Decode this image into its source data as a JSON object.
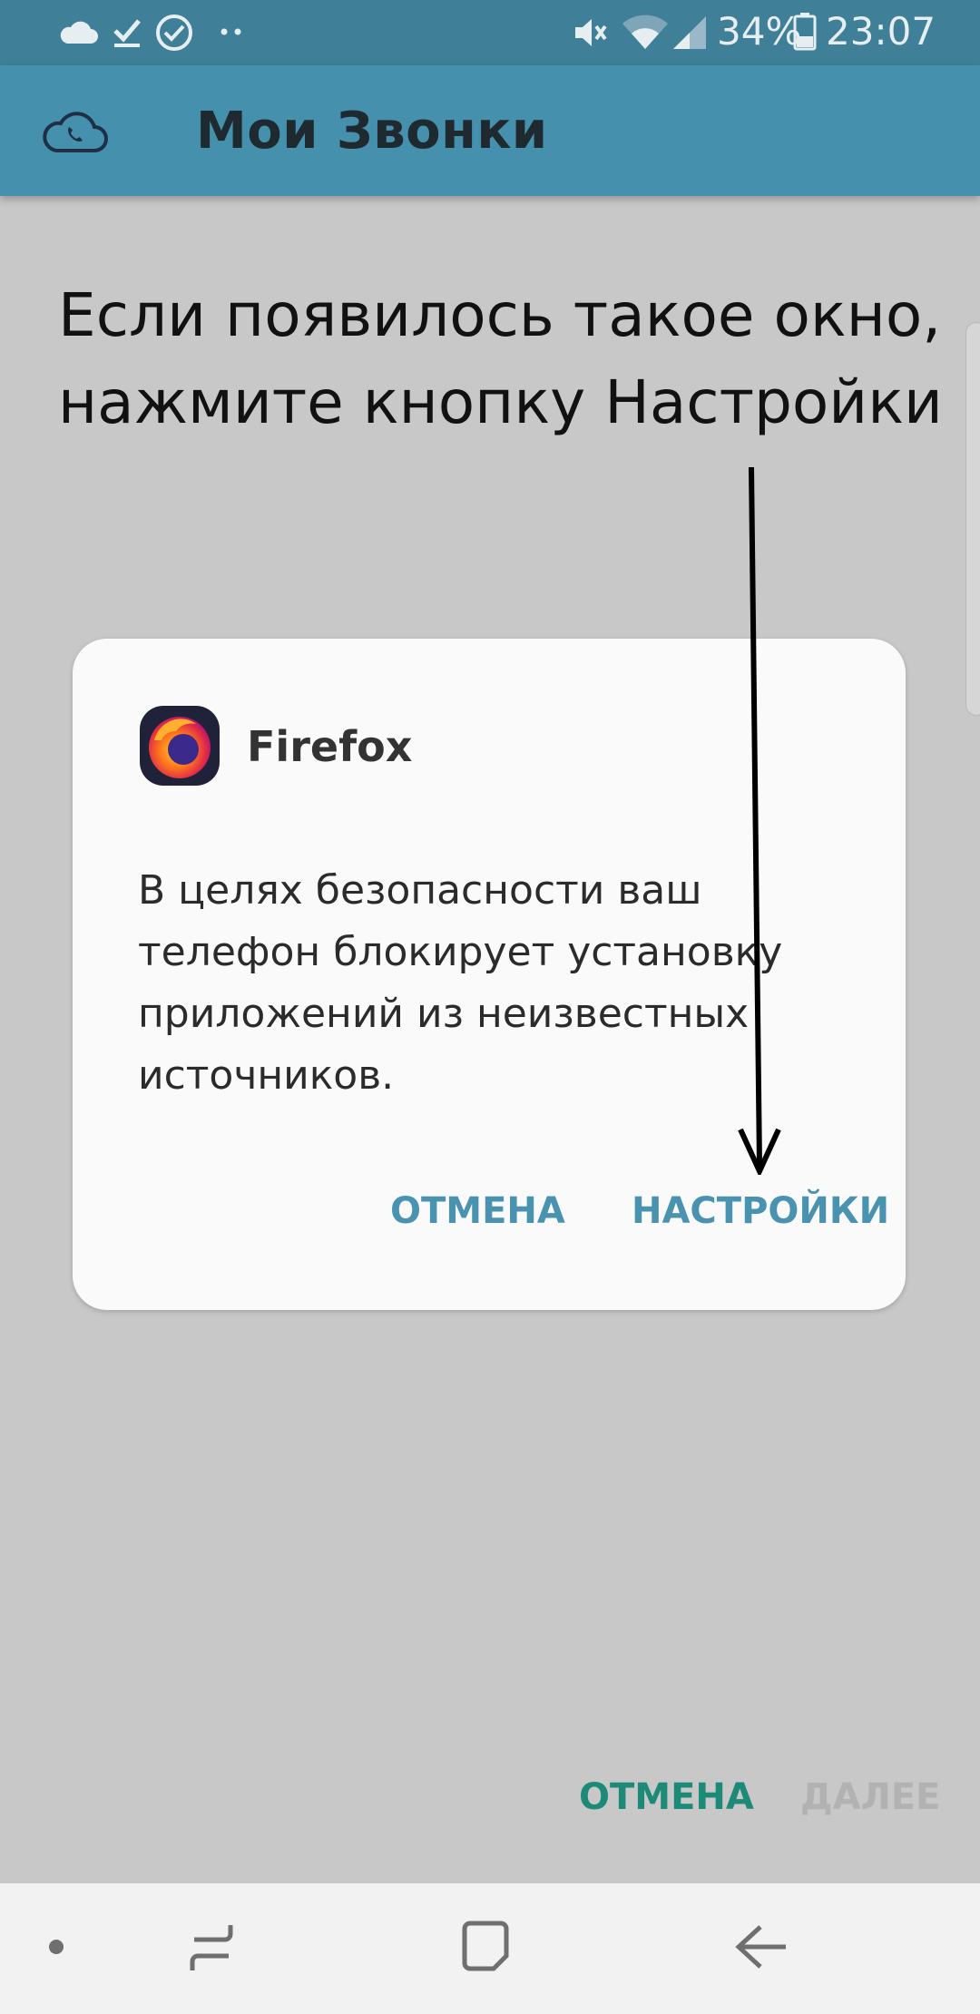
{
  "status_bar": {
    "battery": "34%",
    "time": "23:07",
    "icons": [
      "cloud-icon",
      "download-done-icon",
      "check-circle-icon",
      "more-dots-icon",
      "mute-icon",
      "wifi-icon",
      "signal-icon",
      "battery-icon"
    ]
  },
  "app_bar": {
    "title": "Мои Звонки",
    "logo_icon": "cloud-phone-icon"
  },
  "instruction": {
    "line1": "Если появилось такое окно,",
    "line2": "нажмите кнопку Настройки"
  },
  "dialog": {
    "app_name": "Firefox",
    "app_icon": "firefox-icon",
    "message": "В целях безопасности ваш телефон блокирует установку приложений из неизвестных источников.",
    "cancel_label": "ОТМЕНА",
    "settings_label": "НАСТРОЙКИ"
  },
  "footer_buttons": {
    "cancel_label": "ОТМЕНА",
    "next_label": "ДАЛЕЕ"
  },
  "nav_bar": {
    "items": [
      "dot-icon",
      "recents-icon",
      "home-icon",
      "back-icon"
    ]
  },
  "colors": {
    "app_bar": "#4590ad",
    "status_bar": "#3f7f98",
    "dialog_button": "#4a93b0",
    "footer_cancel": "#1d8a78",
    "footer_next_disabled": "#b2b2b2"
  }
}
